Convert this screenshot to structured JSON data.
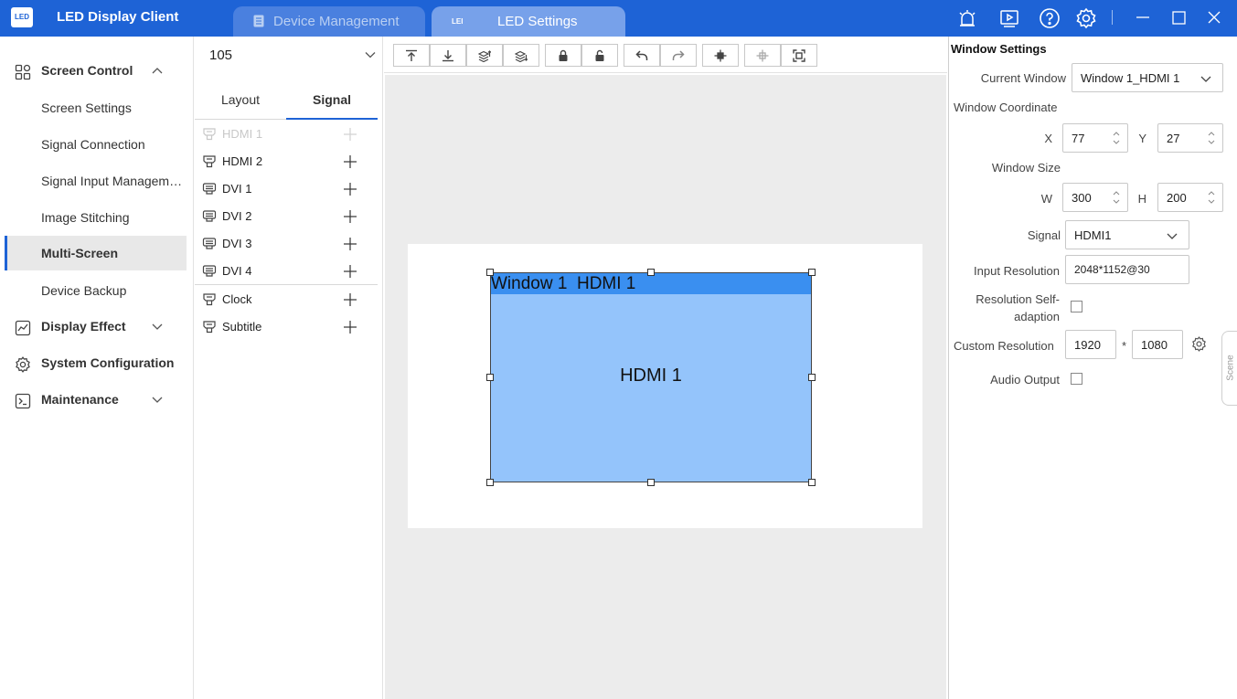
{
  "app": {
    "title": "LED Display Client",
    "logo_text": "LED"
  },
  "tabs": [
    {
      "label": "Device Management",
      "active": false
    },
    {
      "label": "LED Settings",
      "active": true
    }
  ],
  "window_controls": [
    "alarm-icon",
    "play-icon",
    "help-icon",
    "gear-icon",
    "minimize-icon",
    "maximize-icon",
    "close-icon"
  ],
  "sidebar": {
    "groups": [
      {
        "label": "Screen Control",
        "expanded": true,
        "icon": "grid-icon"
      },
      {
        "label": "Display Effect",
        "expanded": false,
        "icon": "chart-icon"
      },
      {
        "label": "System Configuration",
        "expanded": false,
        "icon": "gear-icon"
      },
      {
        "label": "Maintenance",
        "expanded": false,
        "icon": "terminal-icon"
      }
    ],
    "items": [
      {
        "label": "Screen Settings",
        "active": false
      },
      {
        "label": "Signal Connection",
        "active": false
      },
      {
        "label": "Signal Input Management",
        "active": false
      },
      {
        "label": "Image Stitching",
        "active": false
      },
      {
        "label": "Multi-Screen",
        "active": true
      },
      {
        "label": "Device Backup",
        "active": false
      }
    ]
  },
  "signal_panel": {
    "screen_value": "105",
    "tabs": [
      "Layout",
      "Signal"
    ],
    "active_tab": "Signal",
    "signals": [
      {
        "label": "HDMI 1",
        "enabled": false
      },
      {
        "label": "HDMI 2",
        "enabled": true
      },
      {
        "label": "DVI 1",
        "enabled": true
      },
      {
        "label": "DVI 2",
        "enabled": true
      },
      {
        "label": "DVI 3",
        "enabled": true
      },
      {
        "label": "DVI 4",
        "enabled": true
      },
      {
        "label": "Clock",
        "enabled": true
      },
      {
        "label": "Subtitle",
        "enabled": true
      }
    ]
  },
  "toolbar": {
    "buttons": [
      "move-top-icon",
      "move-bottom-icon",
      "layer-up-icon",
      "layer-down-icon",
      "lock-icon",
      "unlock-icon",
      "undo-icon",
      "redo-icon",
      "center-icon",
      "center-disabled-icon",
      "fullscreen-icon"
    ]
  },
  "canvas": {
    "window_title": "Window 1  HDMI 1",
    "window_content": "HDMI 1"
  },
  "window_settings": {
    "title": "Window Settings",
    "current_window_label": "Current Window",
    "current_window_value": "Window 1_HDMI 1",
    "coordinate_label": "Window Coordinate",
    "x_label": "X",
    "x_value": "77",
    "y_label": "Y",
    "y_value": "27",
    "size_label": "Window Size",
    "w_label": "W",
    "w_value": "300",
    "h_label": "H",
    "h_value": "200",
    "signal_label": "Signal",
    "signal_value": "HDMI1",
    "input_resolution_label": "Input Resolution",
    "input_resolution_value": "2048*1152@30",
    "self_adaption_label_line1": "Resolution Self-",
    "self_adaption_label_line2": "adaption",
    "self_adaption_checked": false,
    "custom_resolution_label": "Custom Resolution",
    "custom_width": "1920",
    "custom_sep": "*",
    "custom_height": "1080",
    "audio_output_label": "Audio Output",
    "audio_output_checked": false
  },
  "scene_tab": {
    "label": "Scene"
  }
}
